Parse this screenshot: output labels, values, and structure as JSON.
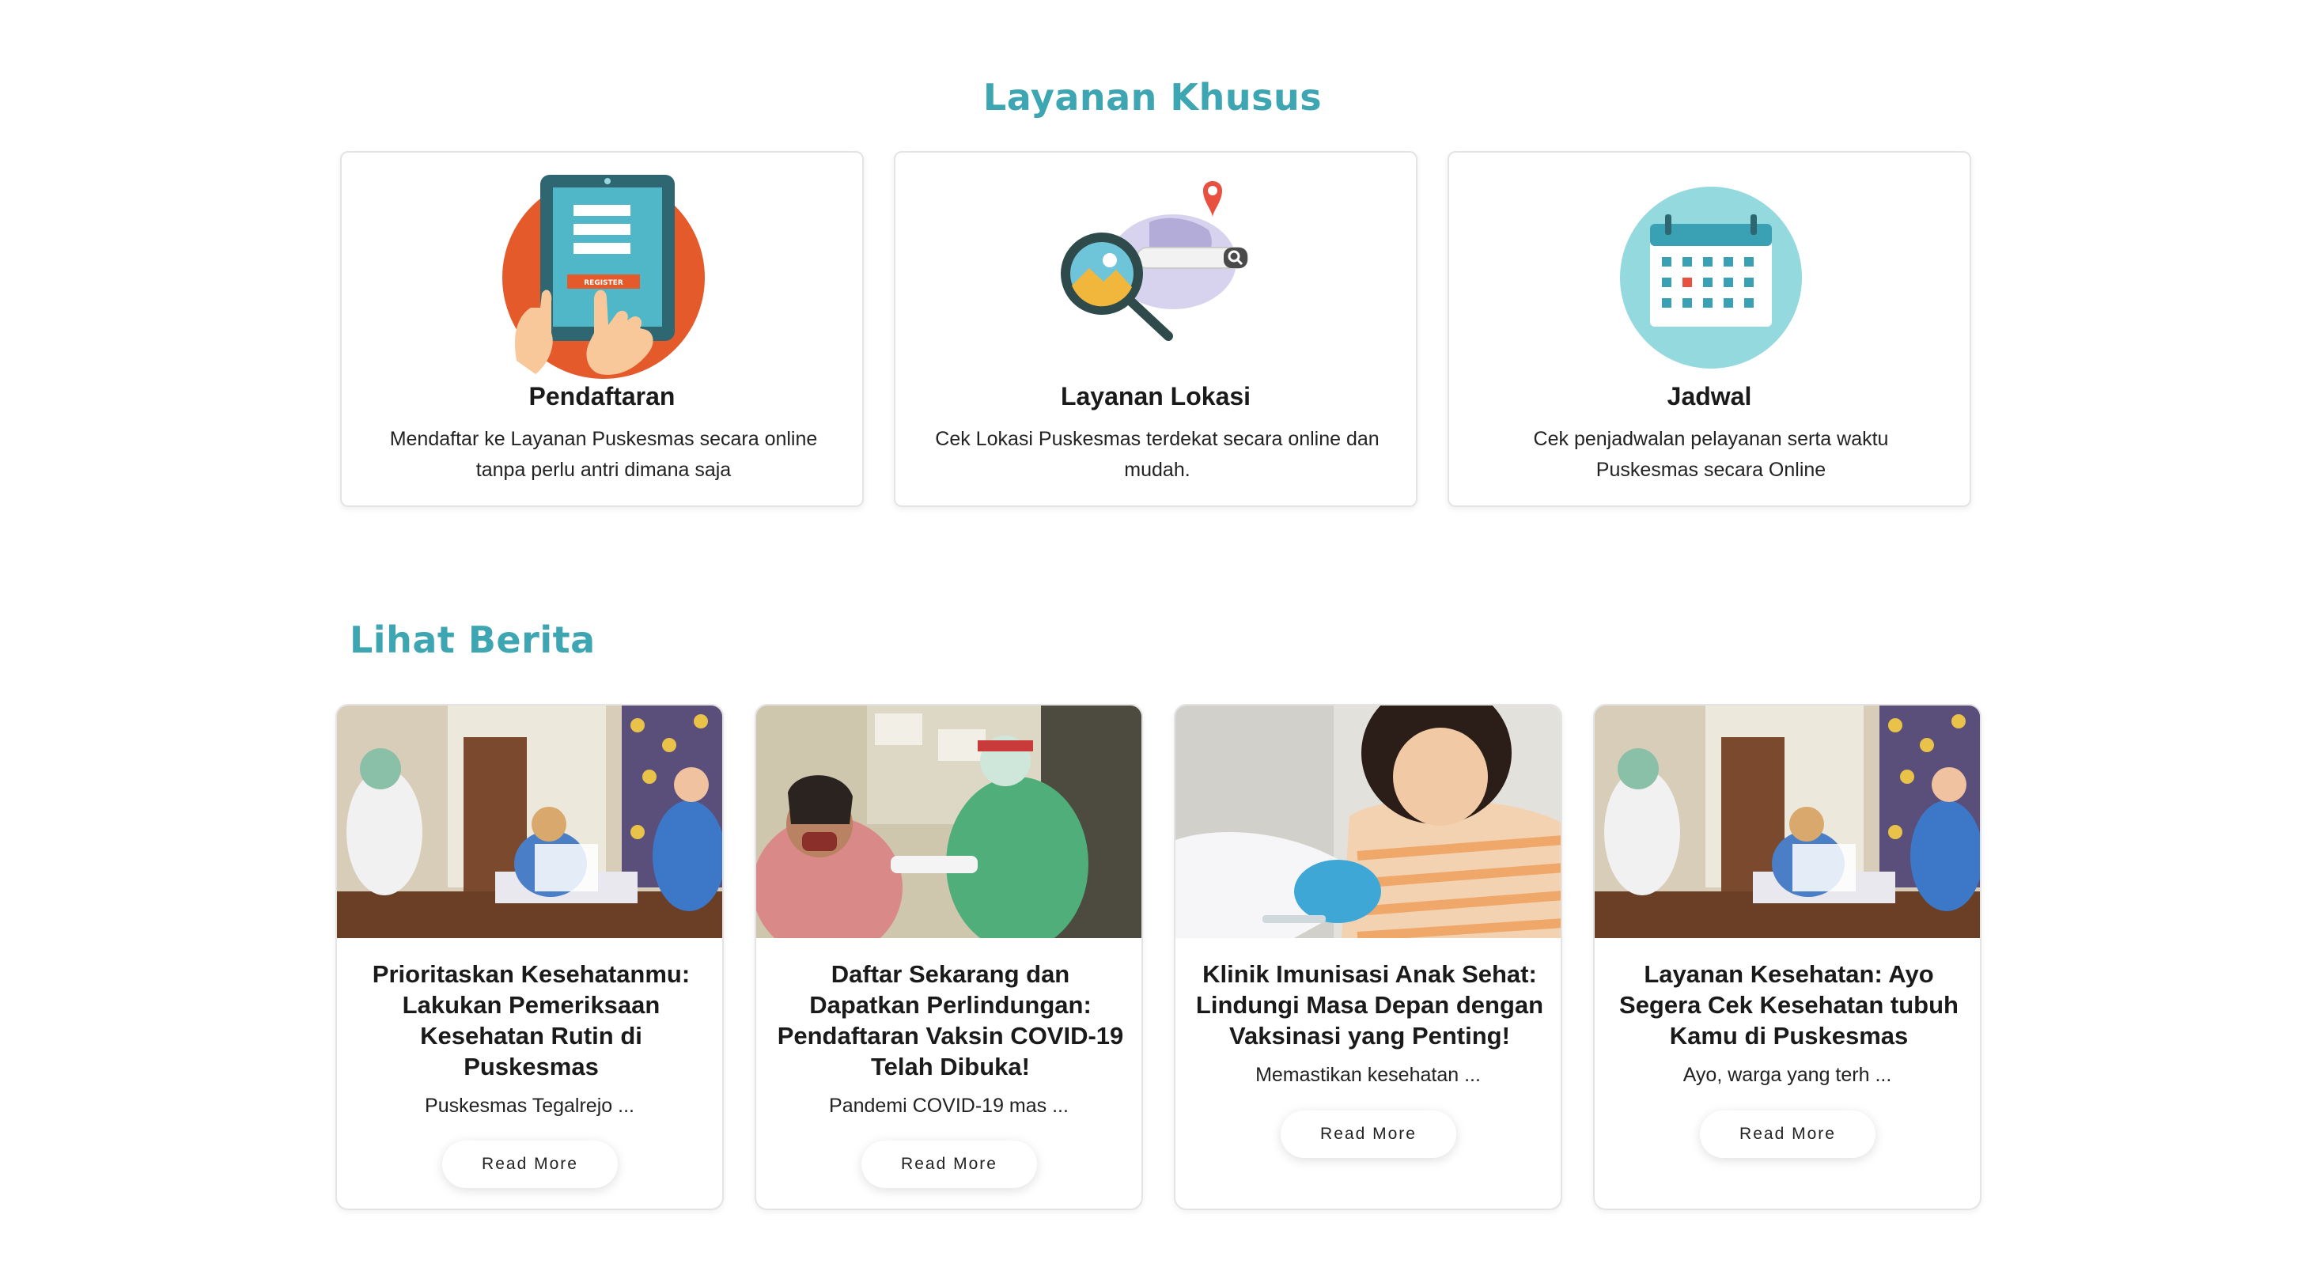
{
  "layanan": {
    "title": "Layanan Khusus",
    "cards": [
      {
        "icon": "registration-tablet-icon",
        "title": "Pendaftaran",
        "desc": "Mendaftar ke Layanan Puskesmas secara online tanpa perlu antri dimana saja",
        "icon_label": "REGISTER"
      },
      {
        "icon": "location-search-icon",
        "title": "Layanan Lokasi",
        "desc": "Cek Lokasi Puskesmas terdekat secara online dan mudah."
      },
      {
        "icon": "calendar-icon",
        "title": "Jadwal",
        "desc": "Cek penjadwalan pelayanan serta waktu Puskesmas secara Online"
      }
    ]
  },
  "berita": {
    "title": "Lihat Berita",
    "read_more_label": "Read More",
    "articles": [
      {
        "title": "Prioritaskan Kesehatanmu: Lakukan Pemeriksaan Kesehatan Rutin di Puskesmas",
        "excerpt": "Puskesmas Tegalrejo ...",
        "image": "clinic-consultation-photo"
      },
      {
        "title": "Daftar Sekarang dan Dapatkan Perlindungan: Pendaftaran Vaksin COVID-19 Telah Dibuka!",
        "excerpt": "Pandemi COVID-19 mas ...",
        "image": "covid-vaccination-photo"
      },
      {
        "title": "Klinik Imunisasi Anak Sehat: Lindungi Masa Depan dengan Vaksinasi yang Penting!",
        "excerpt": "Memastikan kesehatan ...",
        "image": "child-immunization-photo"
      },
      {
        "title": "Layanan Kesehatan: Ayo Segera Cek Kesehatan tubuh Kamu di Puskesmas",
        "excerpt": "Ayo, warga yang terh ...",
        "image": "clinic-consultation-photo"
      }
    ]
  },
  "colors": {
    "accent": "#3da6b2",
    "register_orange": "#e55a2b",
    "calendar_teal": "#94d9de"
  }
}
